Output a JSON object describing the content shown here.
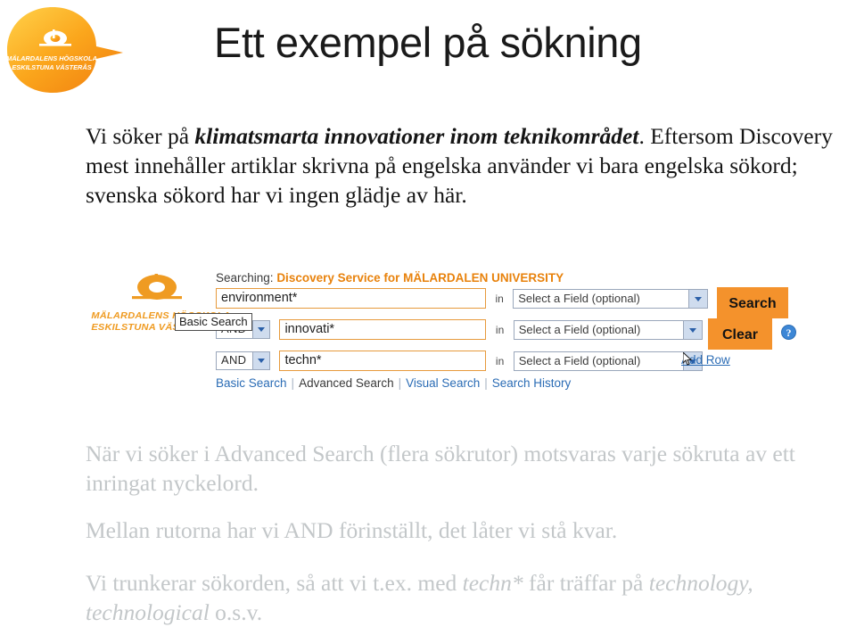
{
  "slide": {
    "title": "Ett exempel på sökning",
    "logo": {
      "name": "malardalens-hogskola-logo",
      "line1": "MÄLARDALENS HÖGSKOLA",
      "line2": "ESKILSTUNA VÄSTERÅS",
      "color_start": "#ffd24a",
      "color_end": "#f08a12"
    },
    "intro": {
      "lead_prefix": "Vi söker på ",
      "lead_bold": "klimatsmarta innovationer inom teknikområdet",
      "lead_suffix": ".",
      "body": "Eftersom Discovery mest innehåller artiklar skrivna på engelska använder vi bara engelska sökord; svenska sökord har vi ingen glädje av här."
    },
    "notes": [
      {
        "id": "note-advanced-search",
        "parts": [
          {
            "text": "När vi söker i Advanced Search (flera sökrutor) motsvaras varje sökruta av ett inringat nyckelord.",
            "style": "normal"
          }
        ]
      },
      {
        "id": "note-and-default",
        "parts": [
          {
            "text": "Mellan rutorna har vi AND förinställt, det låter vi stå kvar.",
            "style": "normal"
          }
        ]
      },
      {
        "id": "note-truncation",
        "parts": [
          {
            "text": "Vi trunkerar sökorden, så att vi t.ex. med ",
            "style": "normal"
          },
          {
            "text": "techn*",
            "style": "italic"
          },
          {
            "text": " får träffar på ",
            "style": "normal"
          },
          {
            "text": "technology, technological",
            "style": "italic"
          },
          {
            "text": " o.s.v.",
            "style": "normal"
          }
        ]
      }
    ]
  },
  "ebsco": {
    "logo": {
      "name": "mdh-logo-small",
      "line1": "MÄLARDALENS HÖGSKOLA",
      "line2": "ESKILSTUNA VÄSTERÅS",
      "color": "#ef9b22"
    },
    "searching_label": "Searching:",
    "service_name": "Discovery Service for MÄLARDALEN UNIVERSITY",
    "tooltip": "Basic Search",
    "rows": [
      {
        "boolean": null,
        "term": "environment*",
        "field_placeholder": "Select a Field (optional)"
      },
      {
        "boolean": "AND",
        "term": "innovati*",
        "field_placeholder": "Select a Field (optional)"
      },
      {
        "boolean": "AND",
        "term": "techn*",
        "field_placeholder": "Select a Field (optional)"
      }
    ],
    "buttons": {
      "search": "Search",
      "clear": "Clear",
      "search_color": "#f4922c"
    },
    "help_icon_label": "?",
    "add_row_link": "Add Row",
    "nav": [
      {
        "label": "Basic Search",
        "current": false
      },
      {
        "label": "Advanced Search",
        "current": true
      },
      {
        "label": "Visual Search",
        "current": false
      },
      {
        "label": "Search History",
        "current": false
      }
    ],
    "nav_separator": "|"
  }
}
